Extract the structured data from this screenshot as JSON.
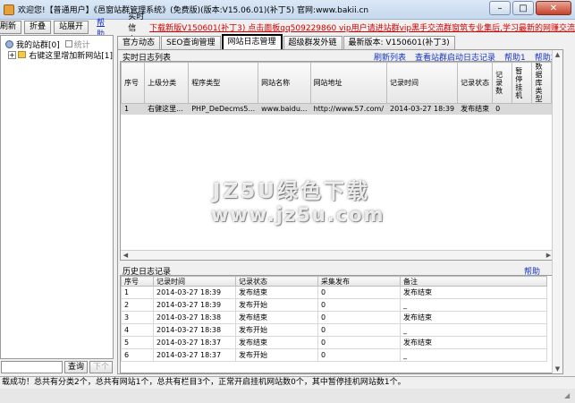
{
  "window": {
    "title": "欢迎您!【普通用户】《邑窗站群管理系统》(免费版)(版本:V15.06.01)(补丁5) 官网:www.bakii.cn",
    "minimize": "–",
    "maximize": "□",
    "close": "✕"
  },
  "toolbar": {
    "refresh": "刷新",
    "collapse": "折叠",
    "expand": "站展开",
    "help": "帮助",
    "realtime_label": "实时信息:",
    "realtime_msg": "下载新版V150601(补丁3)  点击面板qq509229860 vip用户请进站群vip黑手交流群窗筑专业集后,学习最新的网赚交流"
  },
  "tree": {
    "root": "我的站群[0]",
    "root_checkbox": "统计",
    "child": "右键这里增加新网站[1]"
  },
  "left_search": {
    "query": "查询",
    "next": "下个"
  },
  "tabs": [
    "官方动态",
    "SEO查询管理",
    "网站日志管理",
    "超级群发外链",
    "最新版本: V150601(补丁3)"
  ],
  "realtime_log": {
    "title": "实时日志列表",
    "links": [
      "刷新列表",
      "查看站群启动日志记录",
      "帮助1",
      "帮助2"
    ],
    "columns": [
      "序号",
      "上级分类",
      "程序类型",
      "网站名称",
      "网站地址",
      "记录时间",
      "记录状态",
      "记录数",
      "暂停挂机",
      "数据库类型"
    ],
    "rows": [
      [
        "1",
        "右健这里...",
        "PHP_DeDecms5...",
        "www.baidu...",
        "http://www.57.com/",
        "2014-03-27 18:39",
        "发布结束",
        "0",
        "",
        ""
      ]
    ]
  },
  "history_log": {
    "title": "历史日志记录",
    "help": "帮助",
    "columns": [
      "序号",
      "记录时间",
      "记录状态",
      "采集发布",
      "备注"
    ],
    "rows": [
      [
        "1",
        "2014-03-27 18:39",
        "发布结束",
        "0",
        "发布结束"
      ],
      [
        "2",
        "2014-03-27 18:39",
        "发布开始",
        "0",
        "_"
      ],
      [
        "3",
        "2014-03-27 18:38",
        "发布结束",
        "0",
        "发布结束"
      ],
      [
        "4",
        "2014-03-27 18:38",
        "发布开始",
        "0",
        "_"
      ],
      [
        "5",
        "2014-03-27 18:37",
        "发布结束",
        "0",
        "发布结束"
      ],
      [
        "6",
        "2014-03-27 18:37",
        "发布开始",
        "0",
        "_"
      ]
    ]
  },
  "watermark": {
    "line1": "JZ5U绿色下载",
    "line2": "www.jz5u.com"
  },
  "status": "载成功！总共有分类2个，总共有网站1个，总共有栏目3个，正常开启挂机网站数0个，其中暂停挂机网站数1个。"
}
